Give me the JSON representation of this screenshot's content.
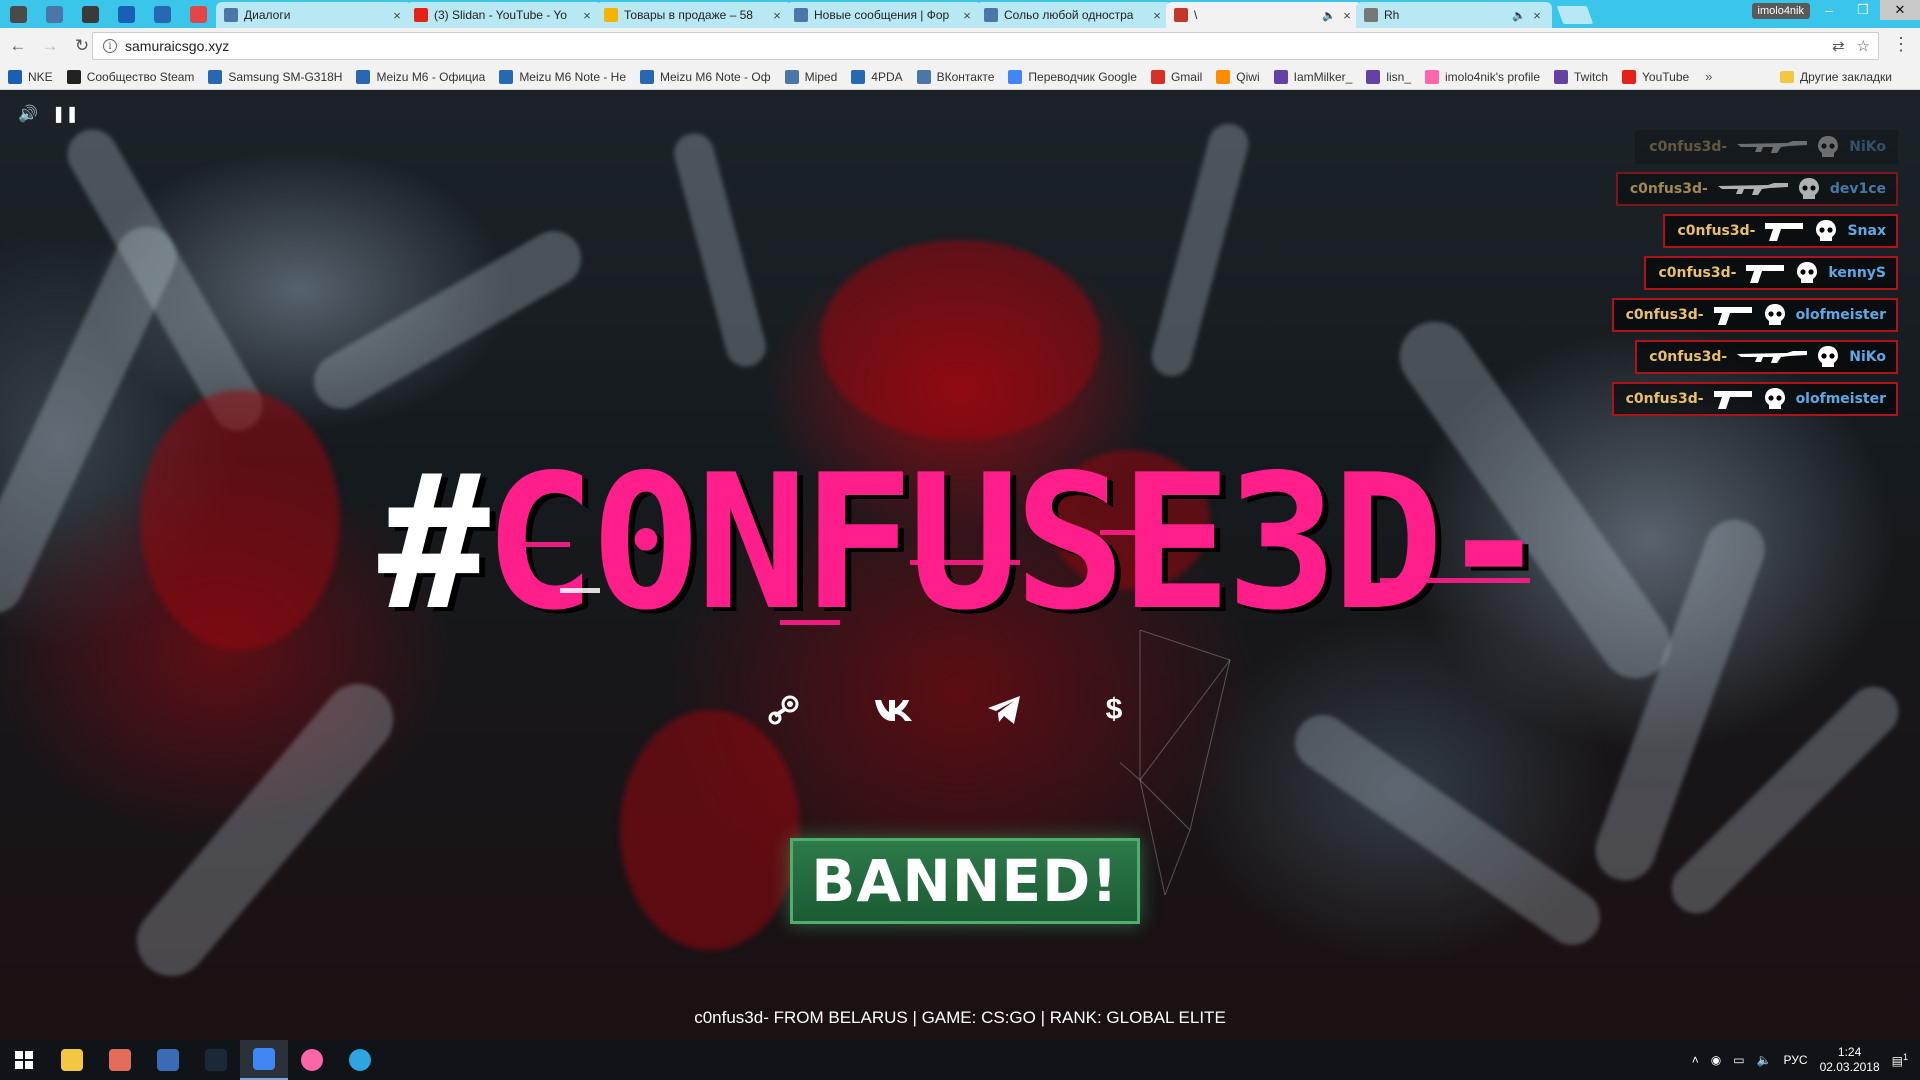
{
  "browser": {
    "pinned_tabs": [
      {
        "icon": "chrome-icon",
        "color": "#4a4a4a"
      },
      {
        "icon": "vk-messages-icon",
        "color": "#4a76a8"
      },
      {
        "icon": "site-icon",
        "color": "#3a3a3a"
      },
      {
        "icon": "calendar-icon",
        "color": "#1a5fb4"
      },
      {
        "icon": "4pda-icon",
        "color": "#2867b2"
      },
      {
        "icon": "pocket-icon",
        "color": "#e64545"
      }
    ],
    "tabs": [
      {
        "title": "Диалоги",
        "icon": "vk-icon",
        "color": "#4a76a8",
        "active": false
      },
      {
        "title": "(3) Slidan - YouTube - Yo",
        "icon": "youtube-icon",
        "color": "#e62117",
        "active": false
      },
      {
        "title": "Товары в продаже – 58",
        "icon": "store-icon",
        "color": "#f5b400",
        "active": false
      },
      {
        "title": "Новые сообщения | Фор",
        "icon": "forum-icon",
        "color": "#4a76a8",
        "active": false
      },
      {
        "title": "Сольо любой однострa",
        "icon": "forum-icon",
        "color": "#4a76a8",
        "active": false
      },
      {
        "title": "\\",
        "icon": "samurai-icon",
        "color": "#c0392b",
        "active": true,
        "audio": true
      },
      {
        "title": "Rh",
        "icon": "site-icon",
        "color": "#777777",
        "active": false,
        "audio": true
      }
    ],
    "profile_name": "imolo4nik",
    "url": "samuraicsgo.xyz",
    "bookmarks": [
      {
        "label": "NKE",
        "icon": "site-icon",
        "color": "#1a5fb4"
      },
      {
        "label": "Сообщество Steam",
        "icon": "steam-icon",
        "color": "#222222"
      },
      {
        "label": "Samsung SM-G318H",
        "icon": "4pda-icon",
        "color": "#2867b2"
      },
      {
        "label": "Meizu M6 - Официа",
        "icon": "4pda-icon",
        "color": "#2867b2"
      },
      {
        "label": "Meizu M6 Note - Не",
        "icon": "4pda-icon",
        "color": "#2867b2"
      },
      {
        "label": "Meizu M6 Note - Оф",
        "icon": "4pda-icon",
        "color": "#2867b2"
      },
      {
        "label": "Miped",
        "icon": "site-icon",
        "color": "#4a76a8"
      },
      {
        "label": "4PDA",
        "icon": "4pda-icon",
        "color": "#2867b2"
      },
      {
        "label": "ВКонтакте",
        "icon": "vk-icon",
        "color": "#4a76a8"
      },
      {
        "label": "Переводчик Google",
        "icon": "translate-icon",
        "color": "#4285f4"
      },
      {
        "label": "Gmail",
        "icon": "gmail-icon",
        "color": "#d93025"
      },
      {
        "label": "Qiwi",
        "icon": "qiwi-icon",
        "color": "#ff8c00"
      },
      {
        "label": "IamMilker_",
        "icon": "twitch-icon",
        "color": "#6441a5"
      },
      {
        "label": "lisn_",
        "icon": "twitch-icon",
        "color": "#6441a5"
      },
      {
        "label": "imolo4nik's profile",
        "icon": "osu-icon",
        "color": "#ff66aa"
      },
      {
        "label": "Twitch",
        "icon": "twitch-icon",
        "color": "#6441a5"
      },
      {
        "label": "YouTube",
        "icon": "youtube-icon",
        "color": "#e62117"
      }
    ],
    "bookmarks_more": "»",
    "other_bookmarks": "Другие закладки"
  },
  "page": {
    "logo_hash": "#",
    "logo_word": "C0NFUSE3D-",
    "accent_color": "#ff1e8a",
    "killfeed": [
      {
        "killer": "c0nfus3d-",
        "weapon": "ak47",
        "victim": "NiKo",
        "style": "fade1"
      },
      {
        "killer": "c0nfus3d-",
        "weapon": "ak47",
        "victim": "dev1ce",
        "style": "fade2"
      },
      {
        "killer": "c0nfus3d-",
        "weapon": "deagle",
        "victim": "Snax",
        "style": ""
      },
      {
        "killer": "c0nfus3d-",
        "weapon": "deagle",
        "victim": "kennyS",
        "style": ""
      },
      {
        "killer": "c0nfus3d-",
        "weapon": "deagle",
        "victim": "olofmeister",
        "style": ""
      },
      {
        "killer": "c0nfus3d-",
        "weapon": "ak47",
        "victim": "NiKo",
        "style": ""
      },
      {
        "killer": "c0nfus3d-",
        "weapon": "deagle",
        "victim": "olofmeister",
        "style": ""
      }
    ],
    "socials": [
      {
        "name": "steam-icon"
      },
      {
        "name": "vk-icon"
      },
      {
        "name": "telegram-icon"
      },
      {
        "name": "donate-icon",
        "glyph": "$"
      }
    ],
    "banned_label": "BANNED!",
    "info_line": "c0nfus3d- FROM BELARUS | GAME: CS:GO | RANK: GLOBAL ELITE"
  },
  "taskbar": {
    "apps": [
      {
        "name": "explorer-icon",
        "color": "#f3c744"
      },
      {
        "name": "paint-icon",
        "color": "#e26d5a"
      },
      {
        "name": "mail-icon",
        "color": "#3b6bb5"
      },
      {
        "name": "steam-icon",
        "color": "#1b2838"
      },
      {
        "name": "chrome-icon",
        "color": "#4285f4",
        "active": true
      },
      {
        "name": "osu-icon",
        "color": "#ff66aa"
      },
      {
        "name": "telegram-icon",
        "color": "#2ca5e0"
      }
    ],
    "language": "РУС",
    "time": "1:24",
    "date": "02.03.2018",
    "notifications": "1"
  }
}
